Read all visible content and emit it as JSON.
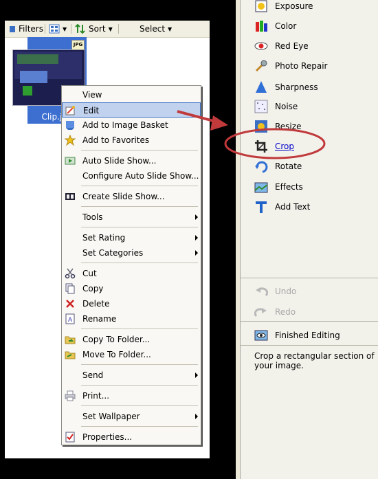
{
  "toolbar": {
    "filters_label": "Filters",
    "sort_label": "Sort",
    "select_label": "Select"
  },
  "thumbnail": {
    "label": "Clip.jpg",
    "badge": "JPG"
  },
  "context_menu": {
    "items": [
      {
        "label": "View",
        "icon": "none"
      },
      {
        "label": "Edit",
        "icon": "edit-icon",
        "highlighted": true
      },
      {
        "label": "Add to Image Basket",
        "icon": "basket-icon"
      },
      {
        "label": "Add to Favorites",
        "icon": "star-icon"
      },
      {
        "label": "Auto Slide Show...",
        "icon": "slideshow-icon"
      },
      {
        "label": "Configure Auto Slide Show...",
        "icon": "none"
      },
      {
        "label": "Create Slide Show...",
        "icon": "film-icon"
      },
      {
        "label": "Tools",
        "submenu": true
      },
      {
        "label": "Set Rating",
        "submenu": true
      },
      {
        "label": "Set Categories",
        "submenu": true
      },
      {
        "label": "Cut",
        "icon": "scissors-icon"
      },
      {
        "label": "Copy",
        "icon": "copy-icon"
      },
      {
        "label": "Delete",
        "icon": "delete-icon"
      },
      {
        "label": "Rename",
        "icon": "rename-icon"
      },
      {
        "label": "Copy To Folder...",
        "icon": "copy-folder-icon"
      },
      {
        "label": "Move To Folder...",
        "icon": "move-folder-icon"
      },
      {
        "label": "Send",
        "submenu": true
      },
      {
        "label": "Print...",
        "icon": "printer-icon"
      },
      {
        "label": "Set Wallpaper",
        "submenu": true
      },
      {
        "label": "Properties...",
        "icon": "properties-icon"
      }
    ]
  },
  "edit_panel": {
    "tools": [
      {
        "label": "Exposure",
        "icon": "exposure-icon"
      },
      {
        "label": "Color",
        "icon": "color-icon"
      },
      {
        "label": "Red Eye",
        "icon": "red-eye-icon"
      },
      {
        "label": "Photo Repair",
        "icon": "repair-icon"
      },
      {
        "label": "Sharpness",
        "icon": "sharpness-icon"
      },
      {
        "label": "Noise",
        "icon": "noise-icon"
      },
      {
        "label": "Resize",
        "icon": "resize-icon"
      },
      {
        "label": "Crop",
        "icon": "crop-icon",
        "hovered": true
      },
      {
        "label": "Rotate",
        "icon": "rotate-icon"
      },
      {
        "label": "Effects",
        "icon": "effects-icon"
      },
      {
        "label": "Add Text",
        "icon": "text-icon"
      }
    ],
    "undo_label": "Undo",
    "redo_label": "Redo",
    "finish_label": "Finished Editing",
    "help_text": "Crop a rectangular section of your image."
  },
  "colors": {
    "highlight": "#c1d2ee",
    "annotation": "#c0393b",
    "link": "#0000cc"
  }
}
